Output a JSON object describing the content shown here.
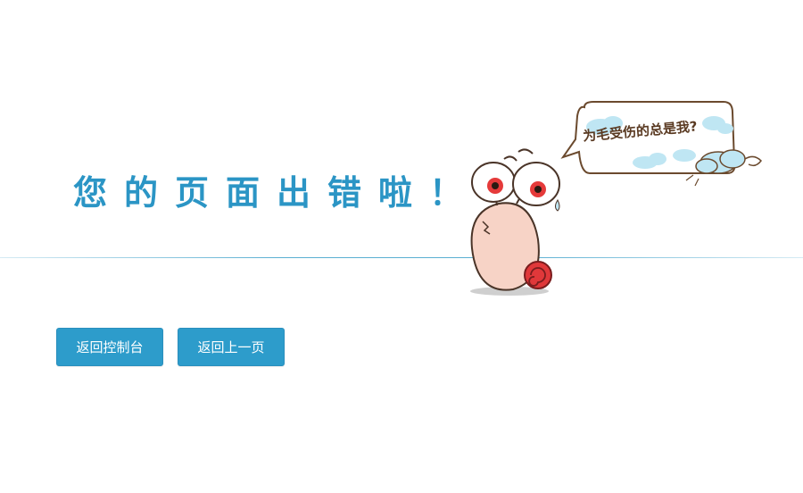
{
  "error": {
    "title": "您的页面出错啦！"
  },
  "actions": {
    "console_label": "返回控制台",
    "back_label": "返回上一页"
  },
  "mascot": {
    "speech_text": "为毛受伤的总是我?",
    "icon": "snail-icon"
  },
  "colors": {
    "accent": "#2d9ccb",
    "title": "#2b95c5",
    "divider": "#5aafd2"
  }
}
